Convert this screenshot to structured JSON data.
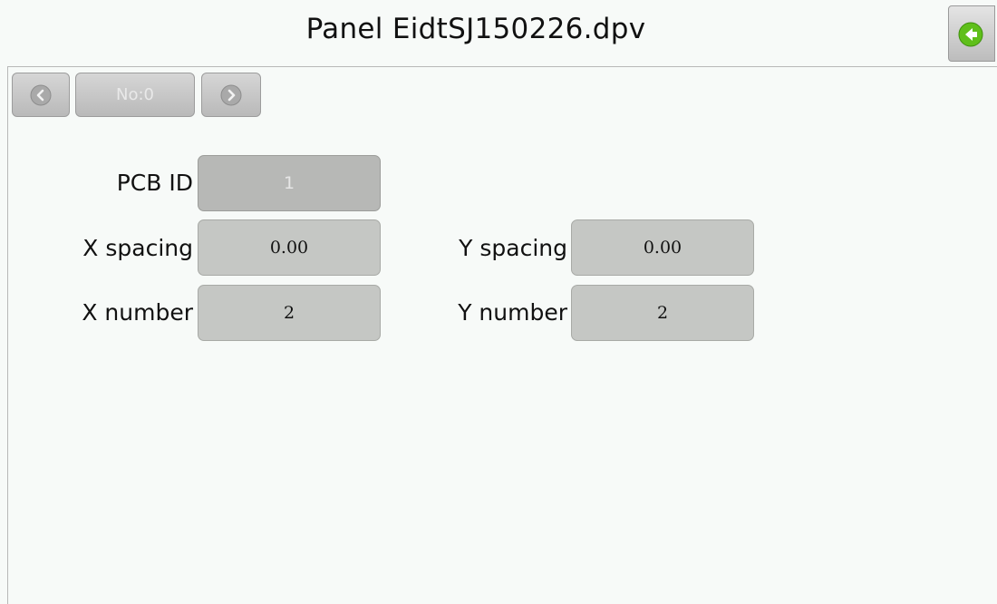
{
  "window": {
    "title": "Panel EidtSJ150226.dpv"
  },
  "navigation": {
    "prev_icon": "chevron-left-icon",
    "record_label": "No:0",
    "next_icon": "chevron-right-icon",
    "back_icon": "back-arrow-icon"
  },
  "form": {
    "pcb_id": {
      "label": "PCB ID",
      "value": "1"
    },
    "x_spacing": {
      "label": "X spacing",
      "value": "0.00"
    },
    "y_spacing": {
      "label": "Y spacing",
      "value": "0.00"
    },
    "x_number": {
      "label": "X number",
      "value": "2"
    },
    "y_number": {
      "label": "Y number",
      "value": "2"
    }
  },
  "colors": {
    "background": "#f7faf8",
    "field": "#c5c7c4",
    "back_icon_green": "#5fbf1a"
  }
}
